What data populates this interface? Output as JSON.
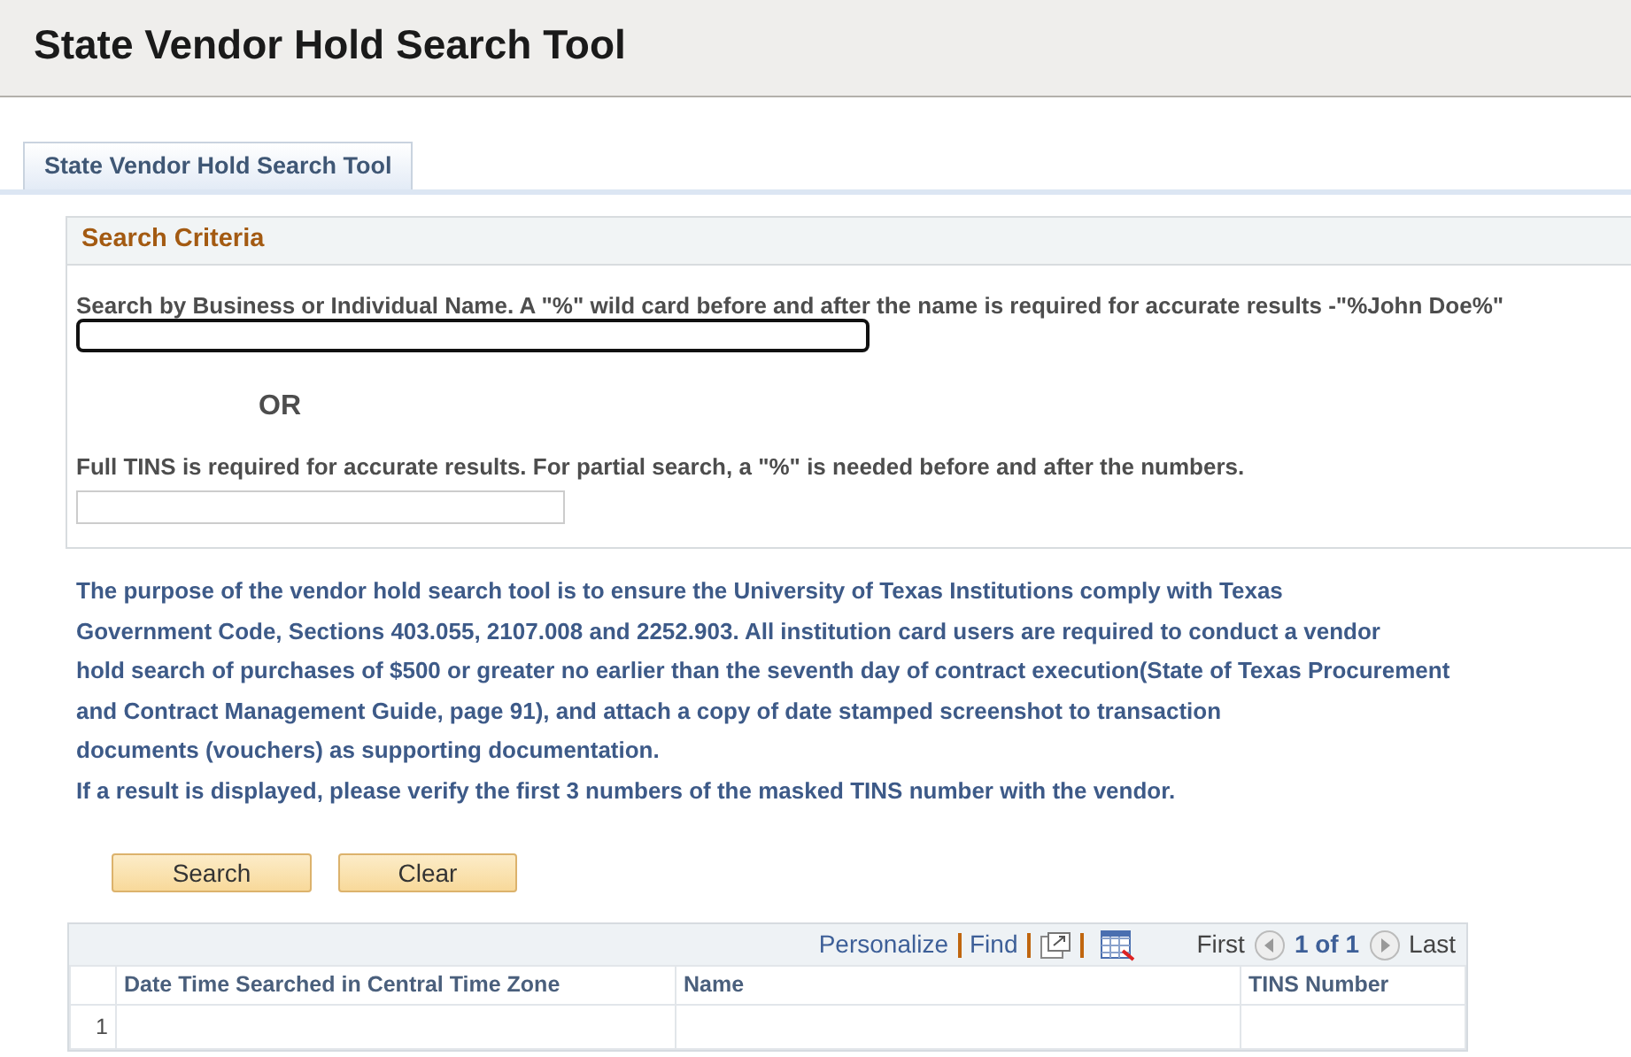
{
  "page_title": "State Vendor Hold Search Tool",
  "tabs": [
    {
      "label": "State Vendor Hold Search Tool",
      "selected": true
    }
  ],
  "search_criteria": {
    "title": "Search Criteria",
    "name_label": "Search by Business or Individual Name. A \"%\" wild card before and after the name is required for accurate results -\"%John Doe%\"",
    "name_field": {
      "focused": true
    },
    "or_text": "OR",
    "tins_label": "Full TINS is required for accurate results. For partial search, a \"%\" is needed before and after the numbers.",
    "tins_field": {
      "focused": false
    }
  },
  "notice_lines": [
    "The purpose of the vendor hold search tool is to ensure the University of Texas Institutions comply with Texas",
    "Government Code, Sections 403.055, 2107.008 and 2252.903. All institution card users are required to conduct a vendor",
    "hold search of purchases of $500 or greater no earlier than the seventh day of contract execution(State of Texas Procurement",
    "and Contract Management Guide, page 91), and attach a copy of date stamped screenshot to transaction",
    "documents (vouchers) as supporting documentation."
  ],
  "verify_note": "If a result is displayed, please verify the first 3 numbers of the masked TINS number with the vendor.",
  "buttons": [
    "Search",
    "Clear"
  ],
  "grid": {
    "toolbar": {
      "personalize": "Personalize",
      "find": "Find",
      "first": "First",
      "page": "1 of 1",
      "last": "Last"
    },
    "columns": [
      "Date Time Searched in Central Time Zone",
      "Name",
      "TINS Number"
    ],
    "rows": [
      {
        "number": "1"
      }
    ]
  }
}
